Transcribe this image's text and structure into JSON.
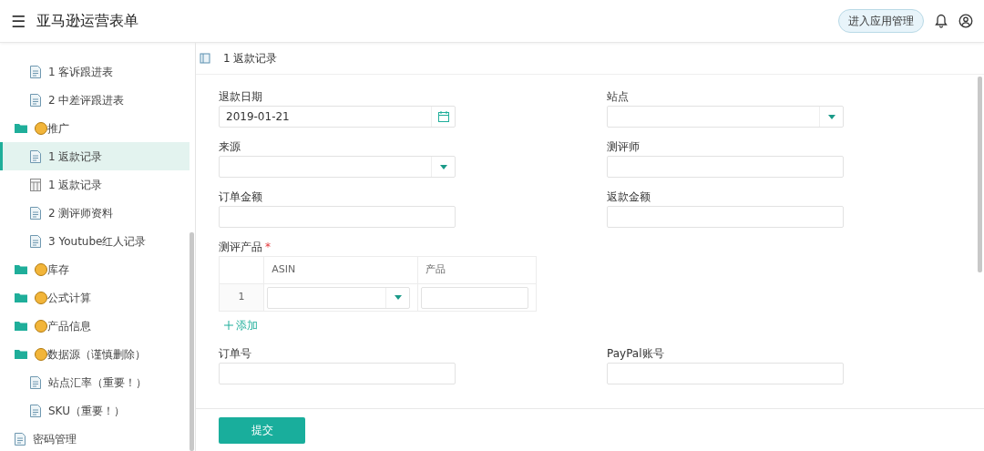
{
  "header": {
    "menu_glyph": "☰",
    "title": "亚马逊运营表单",
    "app_admin_button": "进入应用管理"
  },
  "sidebar": {
    "continued_items": [
      {
        "label": "1 客诉跟进表",
        "kind": "doc",
        "selected": false
      },
      {
        "label": "2 中差评跟进表",
        "kind": "doc",
        "selected": false
      }
    ],
    "items": [
      {
        "label": "推广",
        "kind": "folder",
        "selected": false,
        "children": [
          {
            "label": "1 返款记录",
            "kind": "doc",
            "selected": true
          },
          {
            "label": "1 返款记录",
            "kind": "sheet",
            "selected": false
          },
          {
            "label": "2 测评师资料",
            "kind": "doc",
            "selected": false
          },
          {
            "label": "3 Youtube红人记录",
            "kind": "doc",
            "selected": false
          }
        ]
      },
      {
        "label": "库存",
        "kind": "folder",
        "selected": false
      },
      {
        "label": "公式计算",
        "kind": "folder",
        "selected": false
      },
      {
        "label": "产品信息",
        "kind": "folder",
        "selected": false
      },
      {
        "label": "数据源（谨慎删除）",
        "kind": "folder",
        "selected": false,
        "children": [
          {
            "label": "站点汇率（重要！）",
            "kind": "doc",
            "selected": false
          },
          {
            "label": "SKU（重要！）",
            "kind": "doc",
            "selected": false
          }
        ]
      },
      {
        "label": "密码管理",
        "kind": "doc",
        "selected": false
      }
    ]
  },
  "breadcrumb": "1 返款记录",
  "form": {
    "required_mark": "*",
    "fields": [
      {
        "label": "退款日期",
        "kind": "date",
        "required": false,
        "value": "2019-01-21"
      },
      {
        "label": "站点",
        "kind": "select",
        "required": false
      },
      {
        "label": "来源",
        "kind": "select",
        "required": false
      },
      {
        "label": "测评师",
        "kind": "text",
        "required": false
      },
      {
        "label": "订单金额",
        "kind": "text",
        "required": false
      },
      {
        "label": "返款金额",
        "kind": "text",
        "required": false
      },
      {
        "label": "测评产品",
        "kind": "subtable",
        "required": true,
        "columns": [
          {
            "label": "ASIN",
            "kind": "select"
          },
          {
            "label": "产品",
            "kind": "text"
          }
        ],
        "rows": [
          {
            "index": "1"
          }
        ],
        "add_link": "添加"
      },
      {
        "label": "订单号",
        "kind": "text",
        "required": false
      },
      {
        "label": "PayPal账号",
        "kind": "text",
        "required": false
      }
    ]
  },
  "footer": {
    "submit_button": "提交"
  }
}
